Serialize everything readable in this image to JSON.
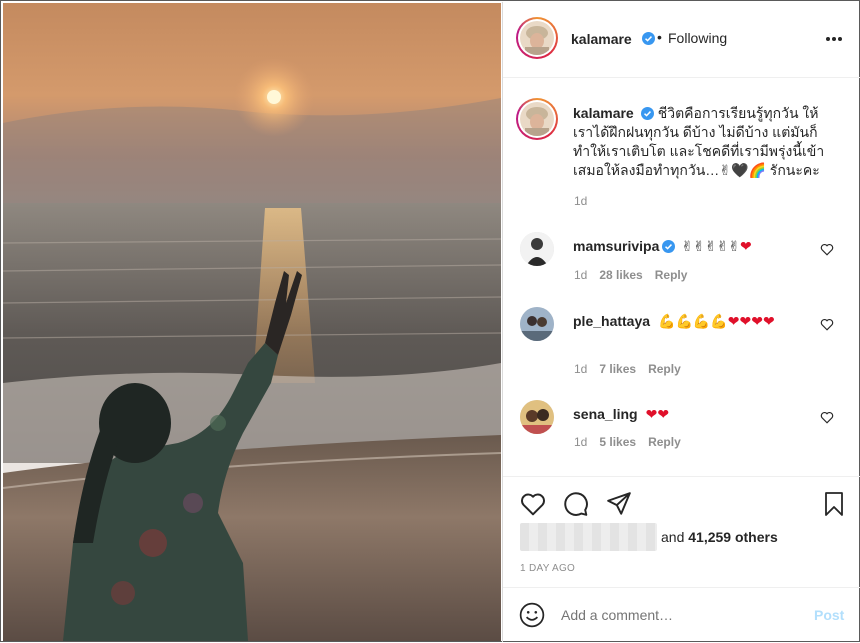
{
  "post": {
    "username": "kalamare",
    "verified": true,
    "follow_status": "Following",
    "separator": "•",
    "more_icon": "more-horizontal-icon"
  },
  "caption": {
    "username": "kalamare",
    "text": "ชีวิตคือการเรียนรู้ทุกวัน ให้เราได้ฝึกฝนทุกวัน ดีบ้าง ไม่ดีบ้าง แต่มันก็ทำให้เราเติบโต และโชคดีที่เรามีพรุ่งนี้เข้าเสมอให้ลงมือทำทุกวัน…✌🖤🌈 รักนะคะ",
    "time": "1d"
  },
  "comments": [
    {
      "username": "mamsurivipa",
      "verified": true,
      "text": "✌✌✌✌✌❤",
      "time": "1d",
      "likes": "28 likes",
      "reply": "Reply"
    },
    {
      "username": "ple_hattaya",
      "verified": false,
      "text": "💪💪💪💪❤❤❤❤",
      "time": "1d",
      "likes": "7 likes",
      "reply": "Reply"
    },
    {
      "username": "sena_ling",
      "verified": false,
      "text": "❤❤",
      "time": "1d",
      "likes": "5 likes",
      "reply": "Reply"
    }
  ],
  "actions": {
    "like_icon": "heart-outline-icon",
    "comment_icon": "comment-bubble-icon",
    "share_icon": "paper-plane-icon",
    "save_icon": "bookmark-icon"
  },
  "likes": {
    "and_text": "and ",
    "count_text": "41,259 others"
  },
  "date": "1 DAY AGO",
  "comment_box": {
    "placeholder": "Add a comment…",
    "post_label": "Post",
    "emoji_icon": "smiley-icon"
  },
  "colors": {
    "verified_blue": "#3897f0",
    "heart_red": "#e0102a",
    "post_disabled": "#b2dffc",
    "sky_top": "#c98a5c",
    "sea": "#6d6660"
  }
}
